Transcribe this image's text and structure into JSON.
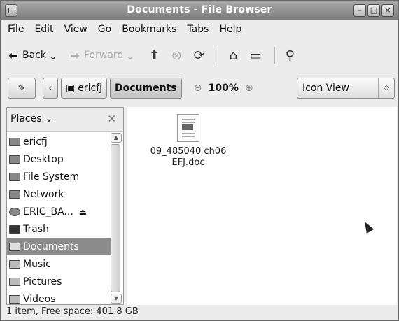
{
  "window": {
    "title": "Documents - File Browser"
  },
  "menubar": {
    "items": [
      "File",
      "Edit",
      "View",
      "Go",
      "Bookmarks",
      "Tabs",
      "Help"
    ]
  },
  "toolbar": {
    "back_label": "Back",
    "forward_label": "Forward"
  },
  "location": {
    "path": [
      "ericfj",
      "Documents"
    ],
    "zoom": "100%",
    "view_mode": "Icon View"
  },
  "sidebar": {
    "header": "Places",
    "items": [
      {
        "label": "ericfj",
        "icon": "home-folder-icon"
      },
      {
        "label": "Desktop",
        "icon": "desktop-icon"
      },
      {
        "label": "File System",
        "icon": "drive-icon"
      },
      {
        "label": "Network",
        "icon": "network-icon"
      },
      {
        "label": "ERIC_BA...",
        "icon": "disc-icon"
      },
      {
        "label": "Trash",
        "icon": "trash-icon"
      },
      {
        "label": "Documents",
        "icon": "folder-icon",
        "selected": true
      },
      {
        "label": "Music",
        "icon": "folder-icon"
      },
      {
        "label": "Pictures",
        "icon": "folder-icon"
      },
      {
        "label": "Videos",
        "icon": "folder-icon"
      }
    ]
  },
  "files": [
    {
      "name_line1": "09_485040 ch06",
      "name_line2": "EFJ.doc",
      "icon": "document-icon"
    }
  ],
  "status": {
    "text": "1 item, Free space: 401.8 GB"
  }
}
